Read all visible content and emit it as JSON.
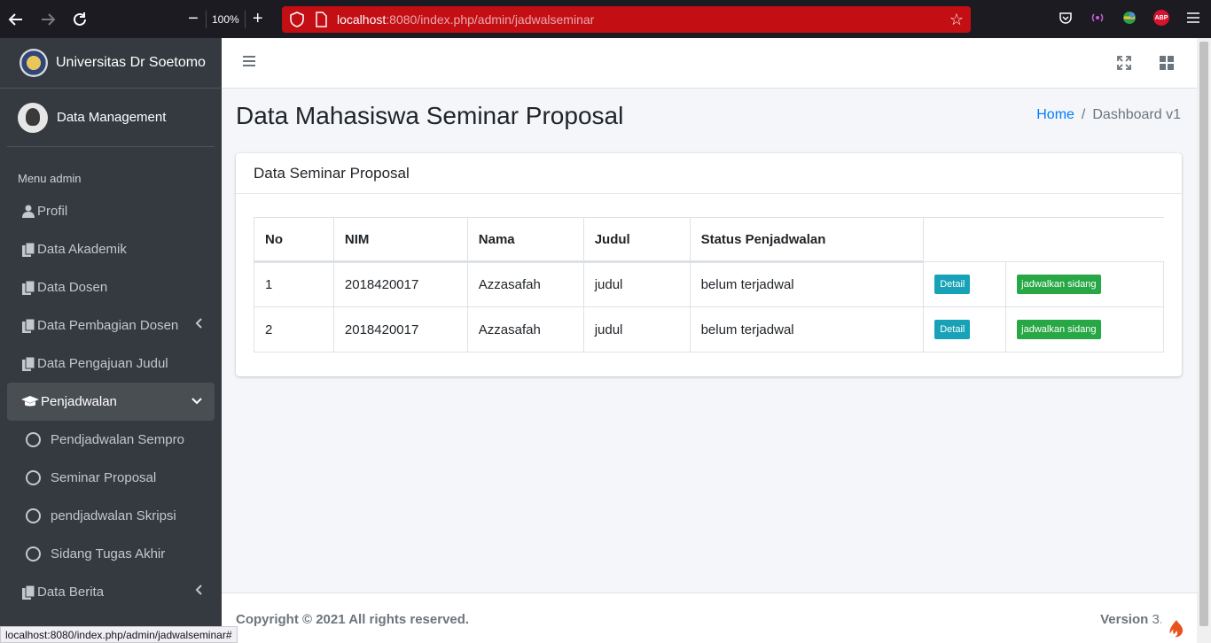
{
  "browser": {
    "zoom": "100%",
    "url_host": "localhost",
    "url_rest": ":8080/index.php/admin/jadwalseminar",
    "status_url": "localhost:8080/index.php/admin/jadwalseminar#",
    "abp_label": "ABP"
  },
  "sidebar": {
    "brand": "Universitas Dr Soetomo",
    "user": "Data Management",
    "menu_header": "Menu admin",
    "items": [
      {
        "label": "Profil",
        "icon": "user-icon"
      },
      {
        "label": "Data Akademik",
        "icon": "copy-icon"
      },
      {
        "label": "Data Dosen",
        "icon": "copy-icon"
      },
      {
        "label": "Data Pembagian Dosen",
        "icon": "copy-icon"
      },
      {
        "label": "Data Pengajuan Judul",
        "icon": "copy-icon"
      },
      {
        "label": "Penjadwalan",
        "icon": "graduation-cap-icon"
      },
      {
        "label": "Data Berita",
        "icon": "copy-icon"
      }
    ],
    "sub_items": [
      {
        "label": "Pendjadwalan Sempro"
      },
      {
        "label": "Seminar Proposal"
      },
      {
        "label": "pendjadwalan Skripsi"
      },
      {
        "label": "Sidang Tugas Akhir"
      }
    ]
  },
  "content": {
    "title": "Data Mahasiswa Seminar Proposal",
    "breadcrumb_home": "Home",
    "breadcrumb_sep": "/",
    "breadcrumb_current": "Dashboard v1",
    "card_title": "Data Seminar Proposal",
    "columns": [
      "No",
      "NIM",
      "Nama",
      "Judul",
      "Status Penjadwalan"
    ],
    "rows": [
      {
        "no": "1",
        "nim": "2018420017",
        "nama": "Azzasafah",
        "judul": "judul",
        "status": "belum terjadwal",
        "detail": "Detail",
        "action": "jadwalkan sidang"
      },
      {
        "no": "2",
        "nim": "2018420017",
        "nama": "Azzasafah",
        "judul": "judul",
        "status": "belum terjadwal",
        "detail": "Detail",
        "action": "jadwalkan sidang"
      }
    ]
  },
  "footer": {
    "copyright": "Copyright © 2021 All rights reserved.",
    "version_label": "Version",
    "version_value": "3."
  }
}
